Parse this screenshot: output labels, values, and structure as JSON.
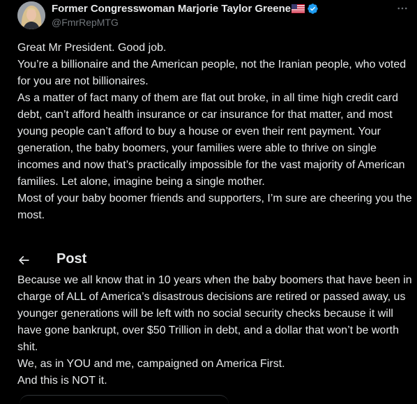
{
  "header": {
    "display_name": "Former Congresswoman Marjorie Taylor Greene",
    "handle": "@FmrRepMTG",
    "flag_icon": "us-flag-icon",
    "verified_icon": "verified-badge-icon",
    "verified_color": "#1d9bf0",
    "more_icon": "more-horizontal-icon"
  },
  "tweet": {
    "paragraphs": [
      "Great Mr President. Good job.",
      "You’re a billionaire and the American people, not the Iranian people, who voted for you are not billionaires.",
      "As a matter of fact many of them are flat out broke, in all time high credit card debt, can’t afford health insurance or car insurance for that matter, and most young people can’t afford to buy a house or even their rent payment. Your generation, the baby boomers, your families were able to thrive on single incomes and now that’s practically impossible for the vast majority of American families. Let alone, imagine being a single mother.",
      "Most of your baby boomer friends and supporters, I’m sure are cheering you the most."
    ],
    "paragraphs_after": [
      "Because we all know that in 10 years when the baby boomers that have been in charge of ALL of America’s disastrous decisions are retired or passed away, us younger generations will be left with no social security checks because it will have gone bankrupt, over $50 Trillion in debt, and a dollar that won’t be worth shit.",
      "We, as in YOU and me, campaigned on America First.",
      "And this is NOT it."
    ]
  },
  "nav": {
    "back_icon": "back-arrow-icon",
    "title": "Post"
  },
  "colors": {
    "background": "#000000",
    "text": "#e7e9ea",
    "muted": "#71767b"
  }
}
